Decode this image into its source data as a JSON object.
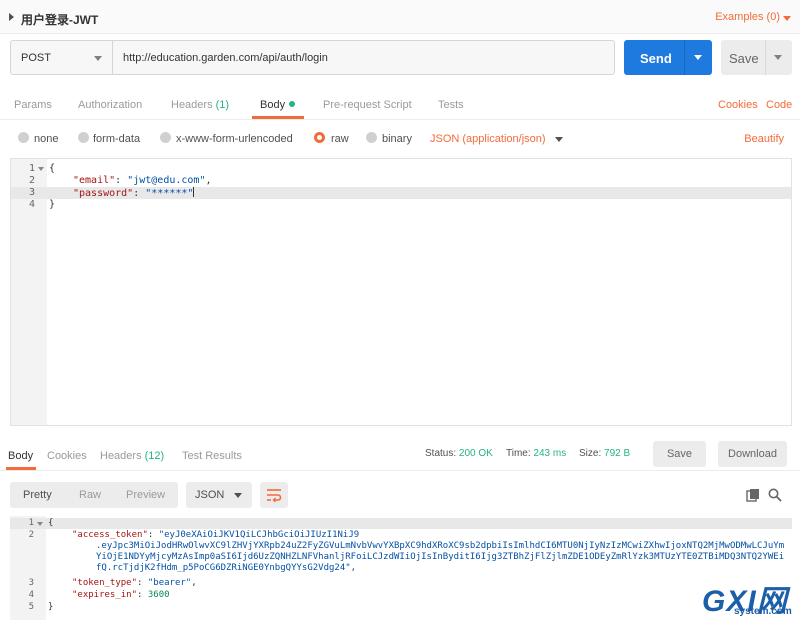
{
  "request": {
    "title": "用户登录-JWT",
    "examples_label": "Examples (0)",
    "method": "POST",
    "url": "http://education.garden.com/api/auth/login",
    "send_label": "Send",
    "save_label": "Save"
  },
  "request_tabs": {
    "params": "Params",
    "authorization": "Authorization",
    "headers": "Headers",
    "headers_count": "(1)",
    "body": "Body",
    "prerequest": "Pre-request Script",
    "tests": "Tests",
    "cookies": "Cookies",
    "code": "Code"
  },
  "body_types": {
    "none": "none",
    "form_data": "form-data",
    "urlencoded": "x-www-form-urlencoded",
    "raw": "raw",
    "binary": "binary",
    "selected": "raw",
    "content_type": "JSON (application/json)",
    "beautify": "Beautify"
  },
  "request_body": {
    "lines": [
      {
        "no": "1",
        "open": "{"
      },
      {
        "no": "2",
        "key": "\"email\"",
        "value": "\"jwt@edu.com\"",
        "tail": ","
      },
      {
        "no": "3",
        "key": "\"password\"",
        "value": "\"******\"",
        "tail": ""
      },
      {
        "no": "4",
        "close": "}"
      }
    ]
  },
  "response_tabs": {
    "body": "Body",
    "cookies": "Cookies",
    "headers": "Headers",
    "headers_count": "(12)",
    "test_results": "Test Results"
  },
  "response_status": {
    "status_label": "Status:",
    "status_value": "200 OK",
    "time_label": "Time:",
    "time_value": "243 ms",
    "size_label": "Size:",
    "size_value": "792 B",
    "save": "Save",
    "download": "Download"
  },
  "response_view": {
    "pretty": "Pretty",
    "raw": "Raw",
    "preview": "Preview",
    "format": "JSON"
  },
  "response_body": {
    "l1": "{",
    "access_token_key": "\"access_token\"",
    "access_token_1": "\"eyJ0eXAiOiJKV1QiLCJhbGciOiJIUzI1NiJ9",
    "access_token_2": ".eyJpc3MiOiJodHRwOlwvXC9lZHVjYXRpb24uZ2FyZGVuLmNvbVwvYXBpXC9hdXRoXC9sb2dpbiIsImlhdCI6MTU0NjIyNzIzMCwiZXhwIjoxNTQ2MjMwODMwLCJuYmYiOjE1NDYyMjcyMzAsImp0aSI6Ijd6UzZQNHZLNFVhanljRFoiLCJzdWIiOjIsInByditI6Ijg3ZTBhZjFlZjlmZDE1ODEyZmRlYzk3MTUzYTE0ZTBiMDQ3NTQ2YWEifQ.rcTjdjK2fHdm_p5PoCG6DZRiNGE0YnbgQYYsG2Vdg24\",",
    "token_type_key": "\"token_type\"",
    "token_type_value": "\"bearer\"",
    "expires_in_key": "\"expires_in\"",
    "expires_in_value": "3600",
    "l5": "}"
  },
  "watermark": {
    "big": "GXI网",
    "small": "system.com"
  },
  "colors": {
    "accent": "#f26b3a",
    "primary": "#1f7ae0",
    "success": "#26b47f"
  }
}
